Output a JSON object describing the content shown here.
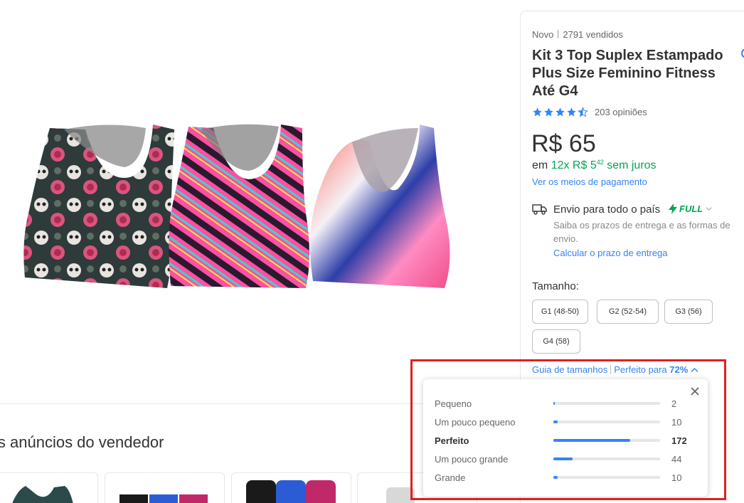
{
  "gallery": {
    "product_image": "three-printed-sports-tops-image",
    "other_ads_title": "is anúncios do vendedor"
  },
  "product": {
    "condition": "Novo",
    "sold": "2791 vendidos",
    "title": "Kit 3 Top Suplex Estampado Plus Size Feminino Fitness Até G4",
    "rating_value": 4.5,
    "reviews": "203 opiniões",
    "price": "R$ 65",
    "installments_prefix": "em",
    "installments_value": "12x R$ 5",
    "installments_cents": "42",
    "installments_suffix": "sem juros",
    "payment_link": "Ver os meios de pagamento"
  },
  "shipping": {
    "icon": "truck-icon",
    "title": "Envio para todo o país",
    "badge": "FULL",
    "subtitle": "Saiba os prazos de entrega e as formas de envio.",
    "link": "Calcular o prazo de entrega"
  },
  "size": {
    "label": "Tamanho:",
    "options": [
      "G1 (48-50)",
      "G2 (52-54)",
      "G3 (56)",
      "G4 (58)"
    ],
    "guide_link": "Guia de tamanhos",
    "fit_text": "Perfeito para",
    "fit_percent": "72%"
  },
  "fit_popup": {
    "rows": [
      {
        "label": "Pequeno",
        "count": "2",
        "fraction": 0.012
      },
      {
        "label": "Um pouco pequeno",
        "count": "10",
        "fraction": 0.04
      },
      {
        "label": "Perfeito",
        "count": "172",
        "fraction": 0.72
      },
      {
        "label": "Um pouco grande",
        "count": "44",
        "fraction": 0.18
      },
      {
        "label": "Grande",
        "count": "10",
        "fraction": 0.04
      }
    ]
  },
  "colors": {
    "accent": "#3483fa",
    "green": "#00a650",
    "highlight": "#e02020"
  }
}
